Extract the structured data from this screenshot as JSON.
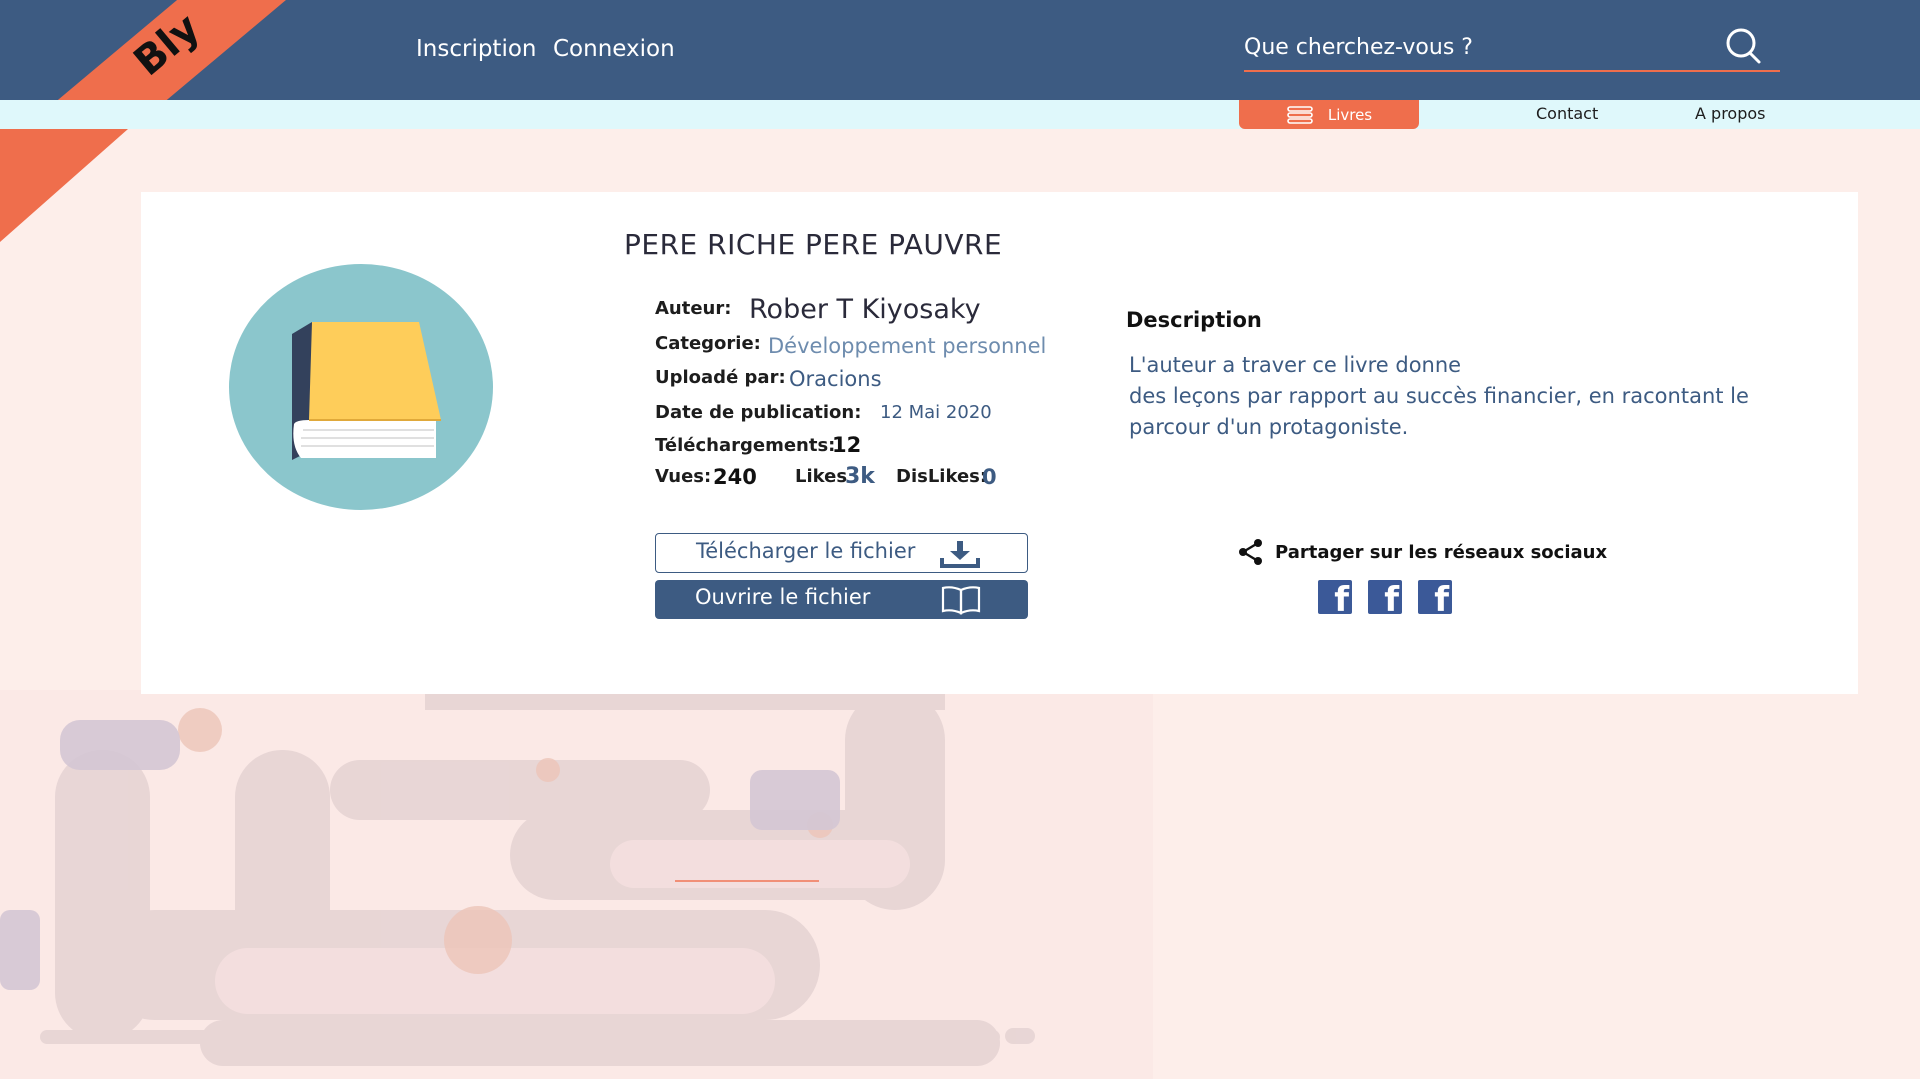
{
  "brand": {
    "logo": "Bly",
    "accent": "#ef6e4c",
    "primary": "#3d5b82"
  },
  "topnav": {
    "inscription": "Inscription",
    "connexion": "Connexion"
  },
  "search": {
    "placeholder": "Que cherchez-vous ?",
    "icon": "search-icon"
  },
  "subnav": {
    "livres": "Livres",
    "contact": "Contact",
    "apropos": "A propos"
  },
  "book": {
    "title": "PERE RICHE PERE PAUVRE",
    "auteur_label": "Auteur:",
    "auteur": "Rober T Kiyosaky",
    "categorie_label": "Categorie:",
    "categorie": "Développement personnel",
    "uploade_label": "Uploadé par:",
    "uploade": "Oracions",
    "date_label": "Date de publication:",
    "date": "12 Mai 2020",
    "telechargements_label": "Téléchargements:",
    "telechargements": "12",
    "vues_label": "Vues:",
    "vues": "240",
    "likes_label": "Likes",
    "likes": "3k",
    "dislikes_label": "DisLikes:",
    "dislikes": "0"
  },
  "description": {
    "title": "Description",
    "text": "L'auteur a traver ce livre donne\n des leçons par rapport au succès financier, en racontant le parcour d'un protagoniste."
  },
  "actions": {
    "telecharger": "Télécharger le fichier",
    "ouvrir": "Ouvrire le fichier"
  },
  "share": {
    "label": "Partager sur les réseaux sociaux",
    "networks": [
      "facebook",
      "facebook",
      "facebook"
    ]
  }
}
